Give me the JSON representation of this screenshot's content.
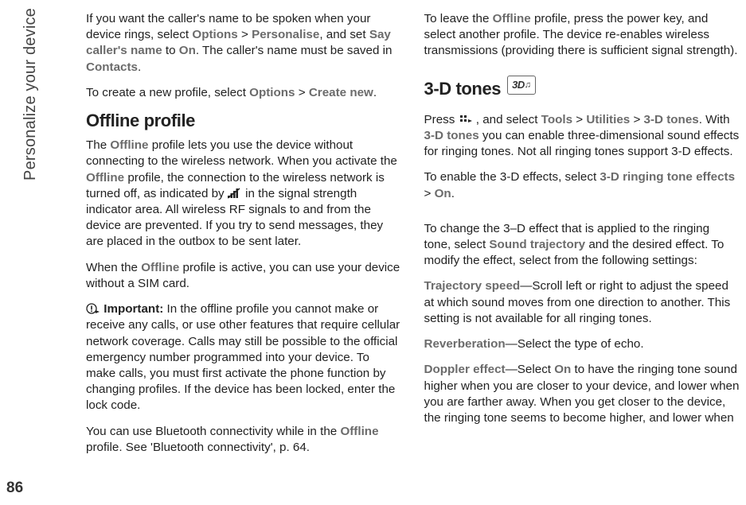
{
  "sidebar": {
    "section_label": "Personalize your device",
    "page_number": "86"
  },
  "col1": {
    "p1": {
      "t1": "If you want the caller's name to be spoken when your device rings, select ",
      "opt1": "Options",
      "sep1": " > ",
      "opt2": "Personalise",
      "t2": ", and set ",
      "opt3": "Say caller's name",
      "t3": " to ",
      "opt4": "On",
      "t4": ". The caller's name must be saved in ",
      "opt5": "Contacts",
      "t5": "."
    },
    "p2": {
      "t1": "To create a new profile, select ",
      "opt1": "Options",
      "sep1": " > ",
      "opt2": "Create new",
      "t2": "."
    },
    "h_offline": "Offline profile",
    "p3": {
      "t1": "The ",
      "opt1": "Offline",
      "t2": " profile lets you use the device without connecting to the wireless network. When you activate the ",
      "opt2": "Offline",
      "t3": " profile, the connection to the wireless network is turned off, as indicated by ",
      "t4": " in the signal strength indicator area. All wireless RF signals to and from the device are prevented. If you try to send messages, they are placed in the outbox to be sent later."
    },
    "p4": {
      "t1": "When the ",
      "opt1": "Offline",
      "t2": " profile is active, you can use your device without a SIM card."
    },
    "p5": {
      "label": "Important:",
      "t1": " In the offline profile you cannot make or receive any calls, or use other features that require cellular network coverage. Calls may still be possible to the official emergency number programmed into your device. To make calls, you must first activate the phone function by changing profiles. If the device has been locked, enter the lock code."
    },
    "p6": {
      "t1": "You can use Bluetooth connectivity while in the ",
      "opt1": "Offline",
      "t2": " profile. See 'Bluetooth connectivity', p. 64."
    }
  },
  "col2": {
    "p1": {
      "t1": "To leave the ",
      "opt1": "Offline",
      "t2": " profile, press the power key, and select another profile. The device re-enables wireless transmissions (providing there is sufficient signal strength)."
    },
    "h_3d": "3-D tones",
    "icon_3d_label": "3D",
    "p2": {
      "t1": "Press ",
      "t2": " , and select ",
      "opt1": "Tools",
      "sep1": " > ",
      "opt2": "Utilities",
      "sep2": " > ",
      "opt3": "3-D tones",
      "t3": ". With ",
      "opt4": "3-D tones",
      "t4": " you can enable three-dimensional sound effects for ringing tones. Not all ringing tones support 3-D effects."
    },
    "p3": {
      "t1": "To enable the 3-D effects, select ",
      "opt1": "3-D ringing tone effects",
      "sep1": " > ",
      "opt2": "On",
      "t2": "."
    },
    "p4": {
      "t1": "To change the 3–D effect that is applied to the ringing tone, select ",
      "opt1": "Sound trajectory",
      "t2": " and the desired effect. To modify the effect, select from the following settings:"
    },
    "p5": {
      "opt1": "Trajectory speed",
      "t1": "—Scroll left or right to adjust the speed at which sound moves from one direction to another. This setting is not available for all ringing tones."
    },
    "p6": {
      "opt1": "Reverberation",
      "t1": "—Select the type of echo."
    },
    "p7": {
      "opt1": "Doppler effect",
      "t1": "—Select ",
      "opt2": "On",
      "t2": " to have the ringing tone sound higher when you are closer to your device, and lower when you are farther away. When you get closer to the device, the ringing tone seems to become higher, and lower when"
    }
  }
}
